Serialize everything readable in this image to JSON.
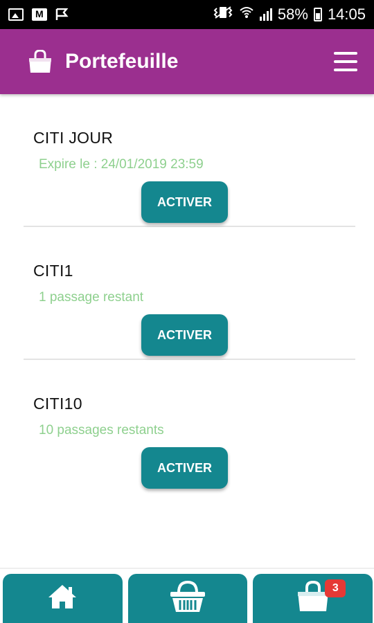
{
  "status_bar": {
    "battery": "58%",
    "time": "14:05"
  },
  "app_bar": {
    "title": "Portefeuille",
    "icon": "shopping-bag-icon",
    "menu_icon": "hamburger-menu-icon"
  },
  "tickets": [
    {
      "name": "CITI JOUR",
      "status": "Expire le : 24/01/2019 23:59",
      "button": "ACTIVER"
    },
    {
      "name": "CITI1",
      "status": "1 passage restant",
      "button": "ACTIVER"
    },
    {
      "name": "CITI10",
      "status": "10 passages restants",
      "button": "ACTIVER"
    }
  ],
  "bottom_nav": {
    "items": [
      {
        "icon": "home-icon"
      },
      {
        "icon": "basket-icon"
      },
      {
        "icon": "shopping-bag-icon",
        "badge": "3"
      }
    ]
  },
  "colors": {
    "app_bar": "#9b2f8f",
    "button": "#14878f",
    "status_text": "#8ed08e",
    "badge": "#e53935"
  }
}
